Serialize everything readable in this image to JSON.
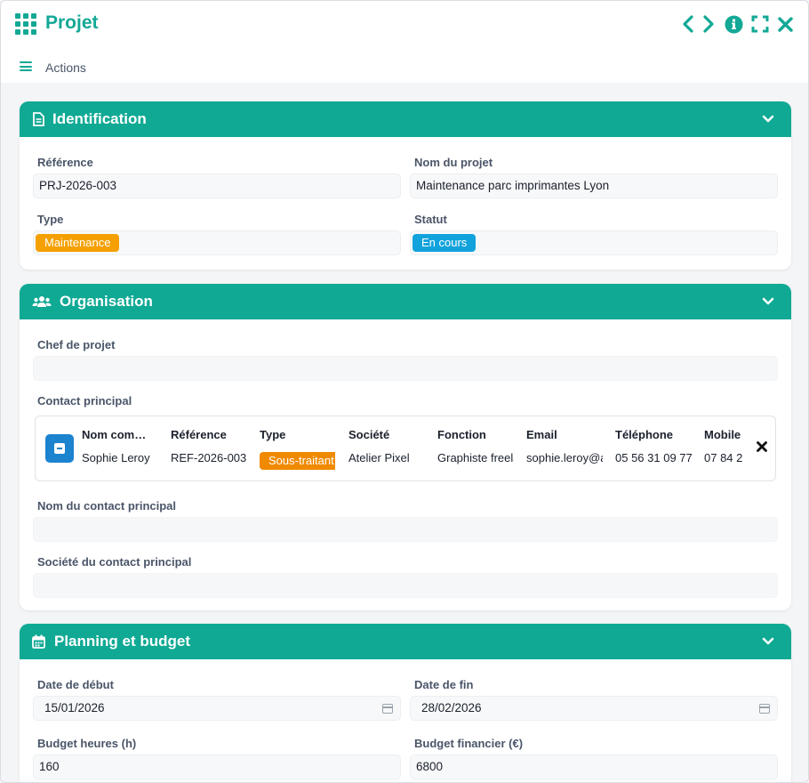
{
  "window": {
    "title": "Projet",
    "app_icon": "grid-icon"
  },
  "toolbar": {
    "actions_label": "Actions"
  },
  "colors": {
    "accent": "#0fa994",
    "maintenance": "#f5a000",
    "en_cours": "#12a3dc",
    "sous_traitant": "#f08a00",
    "contact_avatar": "#1c83cf"
  },
  "identification": {
    "title": "Identification",
    "reference_label": "Référence",
    "reference_value": "PRJ-2026-003",
    "nom_label": "Nom du projet",
    "nom_value": "Maintenance parc imprimantes Lyon",
    "type_label": "Type",
    "type_value": "Maintenance",
    "statut_label": "Statut",
    "statut_value": "En cours"
  },
  "organisation": {
    "title": "Organisation",
    "chef_label": "Chef de projet",
    "chef_value": "",
    "contact_label": "Contact principal",
    "contact_columns": {
      "nom": "Nom com…",
      "reference": "Référence",
      "type": "Type",
      "societe": "Société",
      "fonction": "Fonction",
      "email": "Email",
      "telephone": "Téléphone",
      "mobile": "Mobile"
    },
    "contact_row": {
      "nom": "Sophie Leroy",
      "reference": "REF-2026-003",
      "type": "Sous-traitant",
      "societe": "Atelier Pixel",
      "fonction": "Graphiste freelance",
      "email": "sophie.leroy@atelierpixel.fr",
      "telephone": "05 56 31 09 77",
      "mobile": "07 84 2"
    },
    "nom_contact_label": "Nom du contact principal",
    "nom_contact_value": "",
    "societe_contact_label": "Société du contact principal",
    "societe_contact_value": ""
  },
  "planning": {
    "title": "Planning et budget",
    "date_debut_label": "Date de début",
    "date_debut_value": "15/01/2026",
    "date_fin_label": "Date de fin",
    "date_fin_value": "28/02/2026",
    "budget_heures_label": "Budget heures (h)",
    "budget_heures_value": "160",
    "budget_financier_label": "Budget financier (€)",
    "budget_financier_value": "6800"
  }
}
